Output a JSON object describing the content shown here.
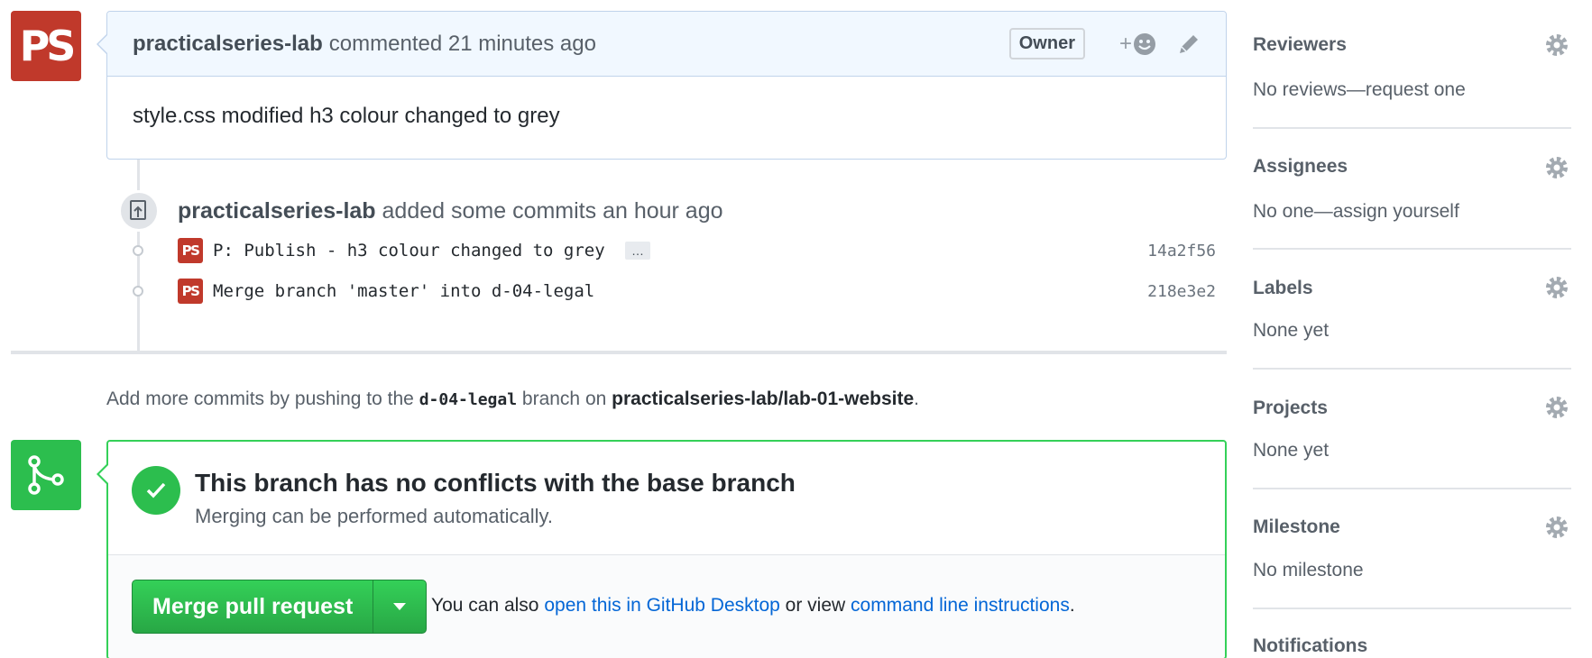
{
  "comment": {
    "avatar_text": "PS",
    "author": "practicalseries-lab",
    "action": "commented 21 minutes ago",
    "badge": "Owner",
    "reaction_plus": "+",
    "body": "style.css modified h3 colour changed to grey"
  },
  "push_event": {
    "author": "practicalseries-lab",
    "action": "added some commits an hour ago",
    "commits": [
      {
        "avatar_text": "PS",
        "message": "P: Publish - h3 colour changed to grey",
        "ellipsis": "…",
        "sha": "14a2f56"
      },
      {
        "avatar_text": "PS",
        "message": "Merge branch 'master' into d-04-legal",
        "sha": "218e3e2"
      }
    ]
  },
  "push_note": {
    "prefix": "Add more commits by pushing to the",
    "branch": "d-04-legal",
    "middle": "branch on",
    "repo": "practicalseries-lab/lab-01-website",
    "suffix": "."
  },
  "merge": {
    "title": "This branch has no conflicts with the base branch",
    "subtitle": "Merging can be performed automatically.",
    "button_label": "Merge pull request",
    "help_prefix": "You can also",
    "desktop_link": "open this in GitHub Desktop",
    "help_middle": "or view",
    "cli_link": "command line instructions",
    "help_suffix": "."
  },
  "sidebar": {
    "sections": [
      {
        "title": "Reviewers",
        "value": "No reviews—request one"
      },
      {
        "title": "Assignees",
        "value": "No one—assign yourself"
      },
      {
        "title": "Labels",
        "value": "None yet"
      },
      {
        "title": "Projects",
        "value": "None yet"
      },
      {
        "title": "Milestone",
        "value": "No milestone"
      },
      {
        "title": "Notifications",
        "value": ""
      }
    ]
  },
  "colors": {
    "accent_green": "#2cbe4e",
    "link_blue": "#0366d6",
    "avatar_red": "#c0392b"
  }
}
